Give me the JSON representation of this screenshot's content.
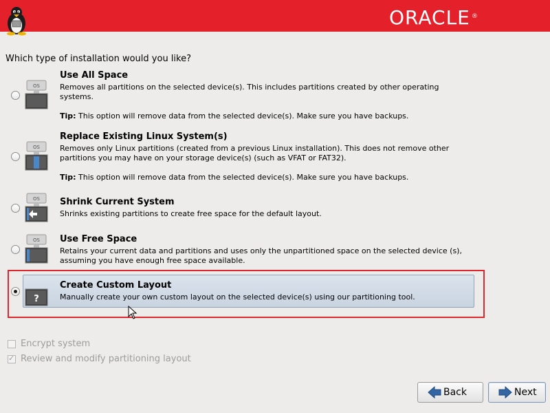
{
  "header": {
    "brand": "ORACLE",
    "brand_reg": "®"
  },
  "question": "Which type of installation would you like?",
  "options": [
    {
      "title": "Use All Space",
      "desc": "Removes all partitions on the selected device(s).  This includes partitions created by other operating systems.",
      "tip_label": "Tip:",
      "tip": " This option will remove data from the selected device(s).  Make sure you have backups.",
      "selected": false,
      "icon": "os-disk-icon"
    },
    {
      "title": "Replace Existing Linux System(s)",
      "desc": "Removes only Linux partitions (created from a previous Linux installation).  This does not remove other partitions you may have on your storage device(s) (such as VFAT or FAT32).",
      "tip_label": "Tip:",
      "tip": " This option will remove data from the selected device(s).  Make sure you have backups.",
      "selected": false,
      "icon": "os-replace-icon"
    },
    {
      "title": "Shrink Current System",
      "desc": "Shrinks existing partitions to create free space for the default layout.",
      "selected": false,
      "icon": "os-shrink-icon"
    },
    {
      "title": "Use Free Space",
      "desc": "Retains your current data and partitions and uses only the unpartitioned space on the selected device (s), assuming you have enough free space available.",
      "selected": false,
      "icon": "os-free-space-icon"
    },
    {
      "title": "Create Custom Layout",
      "desc": "Manually create your own custom layout on the selected device(s) using our partitioning tool.",
      "selected": true,
      "icon": "custom-layout-icon"
    }
  ],
  "icon_text": {
    "os": "OS",
    "custom": "?"
  },
  "checkboxes": {
    "encrypt": {
      "label": "Encrypt system",
      "checked": false
    },
    "review": {
      "label": "Review and modify partitioning layout",
      "checked": true
    }
  },
  "buttons": {
    "back": "Back",
    "next": "Next"
  },
  "colors": {
    "banner": "#e4212b",
    "highlight": "#e0262c",
    "arrow": "#3466a4"
  }
}
